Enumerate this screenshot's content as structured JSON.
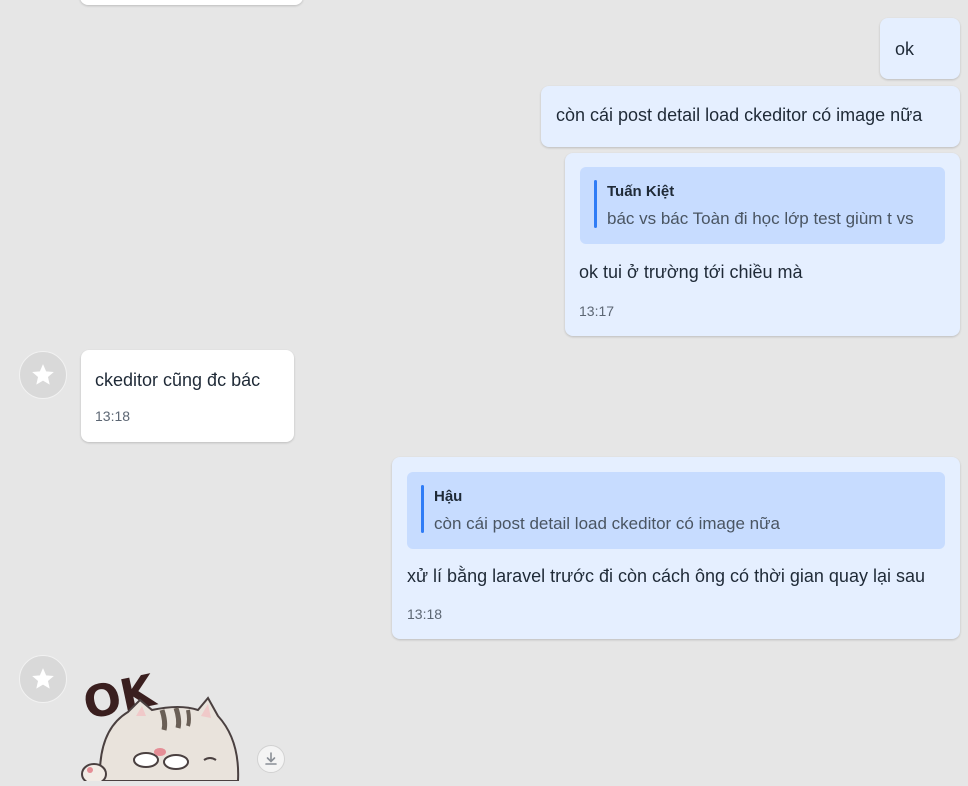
{
  "messages": {
    "m0": {
      "text": "ok"
    },
    "m1": {
      "text": "còn cái post detail load ckeditor có image nữa"
    },
    "m2": {
      "quote_author": "Tuấn Kiệt",
      "quote_text": "bác vs bác Toàn đi học lớp test giùm t vs",
      "text": "ok tui ở trường tới chiều mà",
      "time": "13:17"
    },
    "m3": {
      "text": "ckeditor cũng đc bác",
      "time": "13:18"
    },
    "m4": {
      "quote_author": "Hậu",
      "quote_text": "còn cái post detail load ckeditor có image nữa",
      "text": "xử lí bằng laravel trước đi còn cách ông có thời gian quay lại sau",
      "time": "13:18"
    },
    "m5": {
      "sticker_text": "OK",
      "sticker": "cat-ok-sticker"
    }
  },
  "colors": {
    "background": "#e6e6e6",
    "incoming_bubble": "#ffffff",
    "outgoing_bubble": "#e5efff",
    "quote_background": "#c7dcff",
    "quote_bar": "#2f7cf6"
  },
  "icons": {
    "avatar": "star-icon",
    "download": "download-icon"
  }
}
